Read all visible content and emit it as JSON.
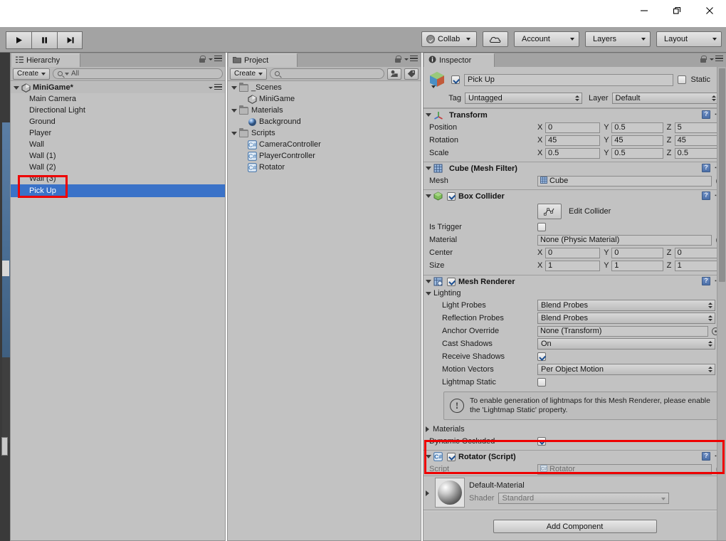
{
  "window": {
    "minimize_label": "minimize",
    "restore_label": "restore",
    "close_label": "close"
  },
  "toolbar": {
    "play_label": "Play",
    "pause_label": "Pause",
    "step_label": "Step",
    "collab_label": "Collab",
    "cloud_label": "Services",
    "account_label": "Account",
    "layers_label": "Layers",
    "layout_label": "Layout"
  },
  "hierarchy": {
    "tab_label": "Hierarchy",
    "create_label": "Create",
    "search_value": "Q All",
    "search_placeholder": "All",
    "root": "MiniGame*",
    "items": [
      {
        "label": "Main Camera",
        "selected": false
      },
      {
        "label": "Directional Light",
        "selected": false
      },
      {
        "label": "Ground",
        "selected": false
      },
      {
        "label": "Player",
        "selected": false
      },
      {
        "label": "Wall",
        "selected": false
      },
      {
        "label": "Wall (1)",
        "selected": false
      },
      {
        "label": "Wall (2)",
        "selected": false
      },
      {
        "label": "Wall (3)",
        "selected": false
      },
      {
        "label": "Pick Up",
        "selected": true
      }
    ]
  },
  "project": {
    "tab_label": "Project",
    "create_label": "Create",
    "search_placeholder": "",
    "tree": [
      {
        "label": "_Scenes",
        "type": "folder",
        "depth": 0
      },
      {
        "label": "MiniGame",
        "type": "scene",
        "depth": 1
      },
      {
        "label": "Materials",
        "type": "folder",
        "depth": 0
      },
      {
        "label": "Background",
        "type": "material",
        "depth": 1
      },
      {
        "label": "Scripts",
        "type": "folder",
        "depth": 0
      },
      {
        "label": "CameraController",
        "type": "script",
        "depth": 1
      },
      {
        "label": "PlayerController",
        "type": "script",
        "depth": 1
      },
      {
        "label": "Rotator",
        "type": "script",
        "depth": 1
      }
    ]
  },
  "inspector": {
    "tab_label": "Inspector",
    "object_name": "Pick Up",
    "object_enabled": true,
    "static_label": "Static",
    "static_checked": false,
    "tag_label": "Tag",
    "tag_value": "Untagged",
    "layer_label": "Layer",
    "layer_value": "Default",
    "transform": {
      "title": "Transform",
      "rows": [
        {
          "label": "Position",
          "x": "0",
          "y": "0.5",
          "z": "5"
        },
        {
          "label": "Rotation",
          "x": "45",
          "y": "45",
          "z": "45"
        },
        {
          "label": "Scale",
          "x": "0.5",
          "y": "0.5",
          "z": "0.5"
        }
      ]
    },
    "mesh_filter": {
      "title": "Cube (Mesh Filter)",
      "mesh_label": "Mesh",
      "mesh_value": "Cube"
    },
    "box_collider": {
      "title": "Box Collider",
      "enabled": true,
      "edit_collider_label": "Edit Collider",
      "is_trigger_label": "Is Trigger",
      "is_trigger_checked": false,
      "material_label": "Material",
      "material_value": "None (Physic Material)",
      "center_label": "Center",
      "center": {
        "x": "0",
        "y": "0",
        "z": "0"
      },
      "size_label": "Size",
      "size": {
        "x": "1",
        "y": "1",
        "z": "1"
      }
    },
    "mesh_renderer": {
      "title": "Mesh Renderer",
      "enabled": true,
      "lighting_label": "Lighting",
      "light_probes_label": "Light Probes",
      "light_probes_value": "Blend Probes",
      "reflection_probes_label": "Reflection Probes",
      "reflection_probes_value": "Blend Probes",
      "anchor_override_label": "Anchor Override",
      "anchor_override_value": "None (Transform)",
      "cast_shadows_label": "Cast Shadows",
      "cast_shadows_value": "On",
      "receive_shadows_label": "Receive Shadows",
      "receive_shadows_checked": true,
      "motion_vectors_label": "Motion Vectors",
      "motion_vectors_value": "Per Object Motion",
      "lightmap_static_label": "Lightmap Static",
      "lightmap_static_checked": false,
      "help_text": "To enable generation of lightmaps for this Mesh Renderer, please enable the 'Lightmap Static' property.",
      "materials_label": "Materials",
      "dynamic_occluded_label": "Dynamic Occluded",
      "dynamic_occluded_checked": true
    },
    "rotator_script": {
      "title": "Rotator (Script)",
      "enabled": true,
      "script_label": "Script",
      "script_value": "Rotator"
    },
    "material": {
      "title": "Default-Material",
      "shader_label": "Shader",
      "shader_value": "Standard"
    },
    "add_component_label": "Add Component"
  },
  "annotations": {
    "highlight_color": "#ee0000",
    "boxes": [
      {
        "name": "pickup-hierarchy-highlight"
      },
      {
        "name": "rotator-script-highlight"
      }
    ]
  }
}
